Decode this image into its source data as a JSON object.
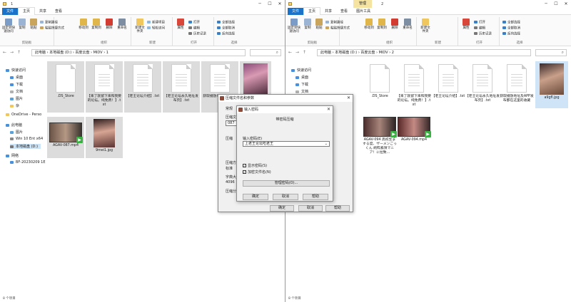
{
  "left": {
    "tabs": [
      "文件",
      "主页",
      "共享",
      "查看"
    ],
    "title": "1",
    "ribbon": {
      "clipboard": {
        "group": "剪贴板",
        "pin": "固定到快速访问",
        "copy": "复制",
        "paste": "粘贴",
        "cut": "剪切",
        "copy_path": "复制路径",
        "paste_shortcut": "粘贴快捷方式"
      },
      "organize": {
        "group": "组织",
        "move_to": "移动到",
        "copy_to": "复制到",
        "delete": "删除",
        "rename": "重命名"
      },
      "new": {
        "group": "新建",
        "new_folder": "新建文件夹",
        "new_item": "新建项目",
        "easy_access": "轻松访问"
      },
      "open": {
        "group": "打开",
        "properties": "属性",
        "open": "打开",
        "edit": "编辑",
        "history": "历史记录"
      },
      "select": {
        "group": "选择",
        "select_all": "全部选择",
        "select_none": "全部取消",
        "invert": "反向选择"
      }
    },
    "breadcrumb": [
      "此电脑",
      "本地磁盘 (D:)",
      "百度云盘",
      "MIDV",
      "1"
    ],
    "files": [
      {
        "name": ".DS_Store",
        "kind": "doc"
      },
      {
        "name": "【来了就留下来和我要的论坛。纯免费！】.txt",
        "kind": "doc"
      },
      {
        "name": "【老王论坛介绍】.txt",
        "kind": "doc"
      },
      {
        "name": "【老王论坛永久地址发布页】.txt",
        "kind": "doc"
      },
      {
        "name": "获取播放地址及APP发布",
        "kind": "doc"
      },
      {
        "name": "",
        "kind": "pic"
      },
      {
        "name": "AGAV-087.mp4",
        "kind": "vid"
      },
      {
        "name": "9mei1.jpg",
        "kind": "pic"
      }
    ],
    "status": "8 个项目"
  },
  "right": {
    "tabs": [
      "文件",
      "主页",
      "共享",
      "查看",
      "图片工具"
    ],
    "manage_tab": "管理",
    "title": "2",
    "breadcrumb": [
      "此电脑",
      "本地磁盘 (D:)",
      "百度云盘",
      "MIDV",
      "2"
    ],
    "files": [
      {
        "name": ".DS_Store",
        "kind": "doc"
      },
      {
        "name": "【来了就留下来和我要的论坛。纯免费！】.txt",
        "kind": "doc"
      },
      {
        "name": "【老王论坛介绍】.txt",
        "kind": "doc"
      },
      {
        "name": "【老王论坛永久地址发布页】.txt",
        "kind": "doc"
      },
      {
        "name": "获取播放地址及APP发布都在这里的收藏",
        "kind": "doc"
      },
      {
        "name": "a9gfl.jpg",
        "kind": "pic"
      },
      {
        "name": "AGAV-094 高校生まする度、ザーメンごっくん 純粋素顔マニア！に拉致…",
        "kind": "vid"
      },
      {
        "name": "AGAV-094.mp4",
        "kind": "vid"
      }
    ],
    "status": "8 个项目"
  },
  "nav": {
    "quick_access": "快速访问",
    "desktop": "桌面",
    "downloads": "下载",
    "documents": "文档",
    "pictures": "图片",
    "misc": "杂",
    "onedrive": "OneDrive - Perso",
    "this_pc": "此电脑",
    "pictures2": "图片",
    "win10": "Win 10 Ent x64",
    "local_disk": "本地磁盘 (D:)",
    "network": "网络",
    "bf": "BF-20230209 1E"
  },
  "dialog_back": {
    "title": "压缩文件名和参数",
    "tab": "常规",
    "label1": "压缩文",
    "value1": "087",
    "label2": "压缩",
    "label3": "压缩方",
    "label4": "标准",
    "label5": "字典大",
    "label6": "4096",
    "label7": "压缩分",
    "ok": "确定",
    "cancel": "取消",
    "help": "帮助"
  },
  "dialog_front": {
    "title": "输入密码",
    "heading": "带密码压缩",
    "pw_label": "输入密码(E)",
    "pw_value": "上老王论坛吃老王",
    "show_pw": "显示密码(S)",
    "encrypt_names": "加密文件名(N)",
    "manage": "管理密码(O)...",
    "ok": "确定",
    "cancel": "取消",
    "help": "帮助"
  }
}
